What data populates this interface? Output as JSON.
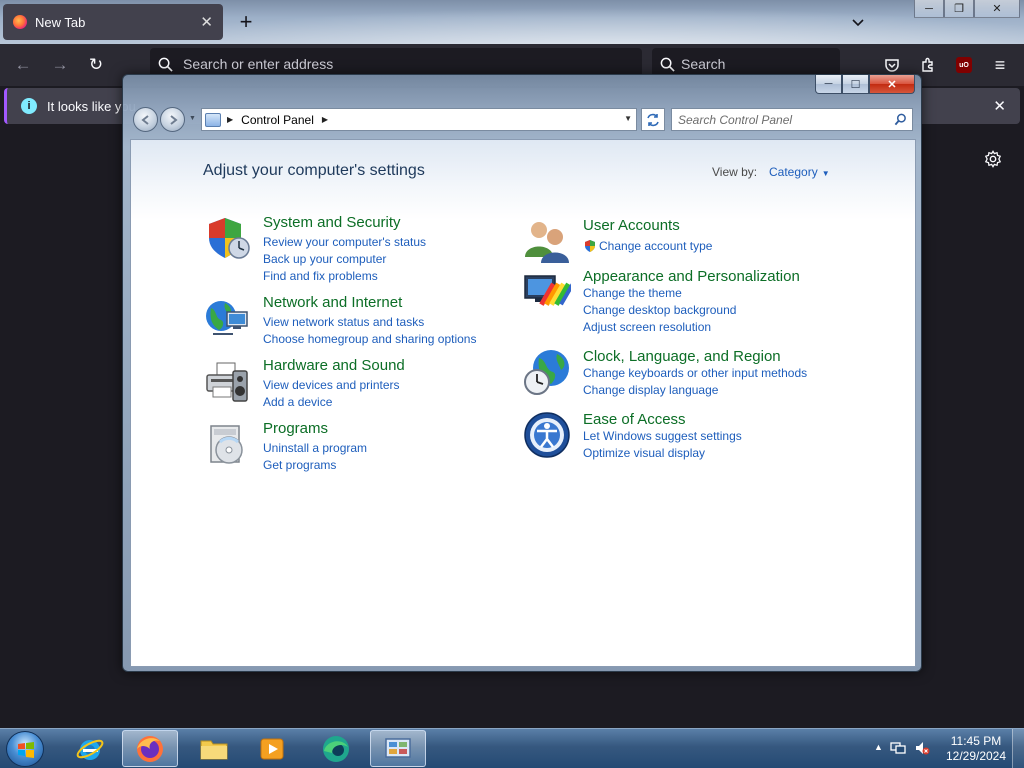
{
  "browser": {
    "tab_title": "New Tab",
    "close_tab_glyph": "✕",
    "new_tab_glyph": "+",
    "list_tabs_glyph": "⌄",
    "back_glyph": "←",
    "forward_glyph": "→",
    "reload_glyph": "↻",
    "url_placeholder": "Search or enter address",
    "search_placeholder": "Search",
    "menu_glyph": "≡",
    "ublock_text": "uO",
    "infobar_text": "It looks like you",
    "infobar_close": "✕"
  },
  "window": {
    "title": "Control Panel",
    "breadcrumb": [
      "Control Panel"
    ],
    "search_placeholder": "Search Control Panel",
    "minimize_glyph": "─",
    "maximize_glyph": "☐",
    "close_glyph": "✕"
  },
  "content": {
    "heading": "Adjust your computer's settings",
    "view_by_label": "View by:",
    "view_by_value": "Category",
    "left_categories": [
      {
        "title": "System and Security",
        "icon": "shield-icon",
        "links": [
          "Review your computer's status",
          "Back up your computer",
          "Find and fix problems"
        ]
      },
      {
        "title": "Network and Internet",
        "icon": "network-globe-icon",
        "links": [
          "View network status and tasks",
          "Choose homegroup and sharing options"
        ]
      },
      {
        "title": "Hardware and Sound",
        "icon": "printer-speaker-icon",
        "links": [
          "View devices and printers",
          "Add a device"
        ]
      },
      {
        "title": "Programs",
        "icon": "programs-disc-icon",
        "links": [
          "Uninstall a program",
          "Get programs"
        ]
      }
    ],
    "right_categories": [
      {
        "title": "User Accounts",
        "icon": "users-icon",
        "links": [
          "Change account type"
        ]
      },
      {
        "title": "Appearance and Personalization",
        "icon": "monitor-palette-icon",
        "links": [
          "Change the theme",
          "Change desktop background",
          "Adjust screen resolution"
        ]
      },
      {
        "title": "Clock, Language, and Region",
        "icon": "globe-clock-icon",
        "links": [
          "Change keyboards or other input methods",
          "Change display language"
        ]
      },
      {
        "title": "Ease of Access",
        "icon": "ease-of-access-icon",
        "links": [
          "Let Windows suggest settings",
          "Optimize visual display"
        ]
      }
    ]
  },
  "taskbar": {
    "pinned": [
      "internet-explorer-icon",
      "firefox-icon",
      "file-explorer-icon",
      "media-player-icon",
      "edge-icon",
      "control-panel-icon"
    ],
    "time": "11:45 PM",
    "date": "12/29/2024",
    "tray_arrow": "▲"
  },
  "colors": {
    "link_blue": "#1e5ebc",
    "category_green": "#0c6e26",
    "heading_blue": "#1e395b",
    "firefox_dark": "#2b2a33"
  }
}
